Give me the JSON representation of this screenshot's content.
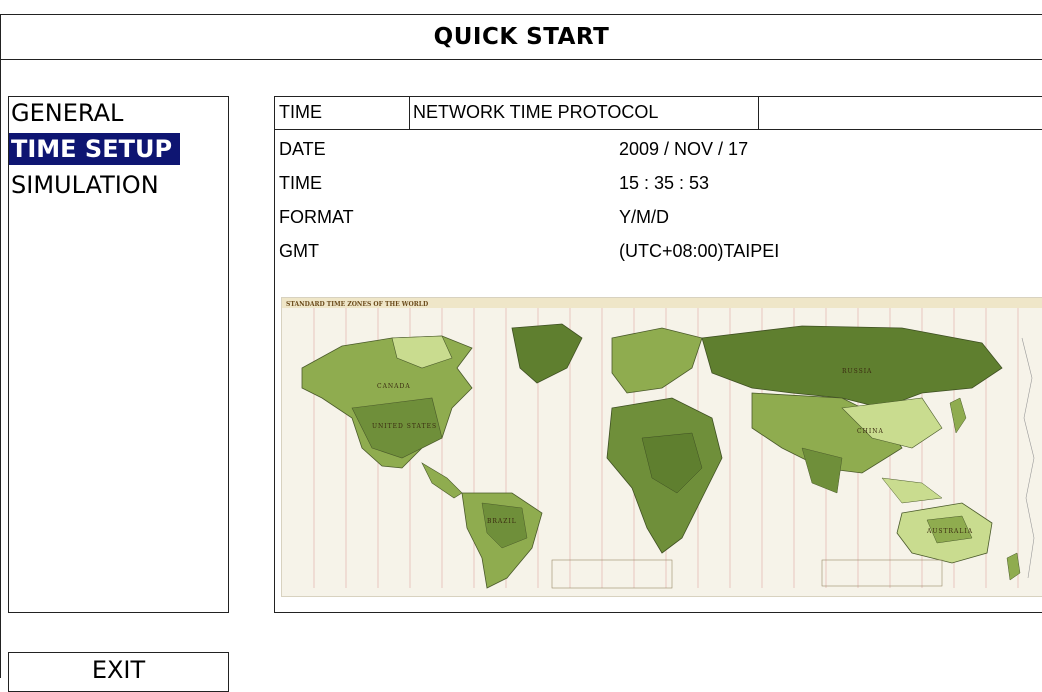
{
  "header": {
    "title": "QUICK START"
  },
  "menu": {
    "items": [
      {
        "label": "GENERAL"
      },
      {
        "label": "TIME SETUP"
      },
      {
        "label": "SIMULATION"
      }
    ],
    "selected_index": 1,
    "exit_label": "EXIT"
  },
  "time_setup": {
    "sync_label": "TIME",
    "sync_mode": "NETWORK TIME PROTOCOL",
    "fields": [
      {
        "label": "DATE",
        "value": "2009 / NOV / 17"
      },
      {
        "label": "TIME",
        "value": "15 : 35 : 53"
      },
      {
        "label": "FORMAT",
        "value": "Y/M/D"
      },
      {
        "label": "GMT",
        "value": "(UTC+08:00)TAIPEI"
      }
    ]
  },
  "map": {
    "title": "STANDARD TIME ZONES OF THE WORLD",
    "labels": [
      "CANADA",
      "UNITED STATES",
      "BRAZIL",
      "RUSSIA",
      "CHINA",
      "AUSTRALIA"
    ]
  },
  "colors": {
    "selected_bg": "#0e1572",
    "selected_fg": "#ffffff",
    "border": "#222222",
    "map_land_dark": "#5f7f2f",
    "map_land_mid": "#8fac4f",
    "map_land_light": "#c9dc8f",
    "map_ocean": "#f6f3e9"
  }
}
